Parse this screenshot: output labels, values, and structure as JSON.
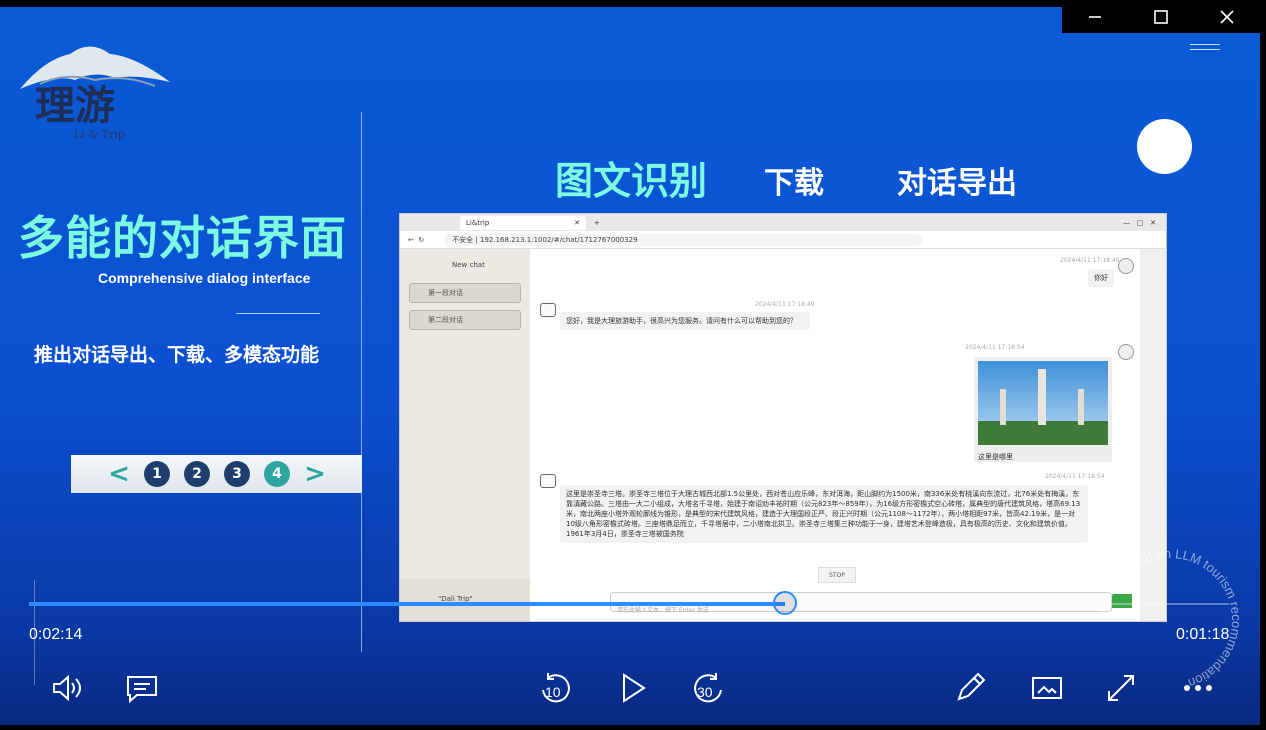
{
  "window": {
    "minimize_icon": "minimize-icon",
    "maximize_icon": "maximize-icon",
    "close_icon": "close-icon"
  },
  "slide": {
    "logo_text": "理游",
    "logo_subtext": "Li & Trip",
    "title_cn": "多能的对话界面",
    "title_en": "Comprehensive dialog interface",
    "subtitle": "推出对话导出、下载、多模态功能",
    "features": [
      "图文识别",
      "下载",
      "对话导出"
    ],
    "pager": {
      "prev": "<",
      "next": ">",
      "pages": [
        "1",
        "2",
        "3",
        "4"
      ],
      "active": "4"
    }
  },
  "browser": {
    "tab_title": "Li&trip",
    "url_warning": "不安全",
    "url": "192.168.213.1:1002/#/chat/1712767000329",
    "sidebar": {
      "new_chat": "New chat",
      "items": [
        "第一段对话",
        "第二段对话"
      ],
      "footer_name": "\"Dali Trip\""
    },
    "messages": [
      {
        "role": "user",
        "time": "2024/4/11 17:18:46",
        "text": "你好"
      },
      {
        "role": "bot",
        "time": "2024/4/11 17:18:49",
        "text": "您好，我是大理旅游助手，很高兴为您服务。请问有什么可以帮助到您的？"
      },
      {
        "role": "user",
        "time": "2024/4/11 17:18:54",
        "text": "这里是哪里"
      },
      {
        "role": "bot",
        "time": "2024/4/11 17:18:54",
        "text": "这里是崇圣寺三塔。崇圣寺三塔位于大理古城西北部1.5公里处，西对苍山应乐峰，东对洱海，距山脚约为1500米，南336米处有桃溪向东流过，北76米处有梅溪，东靠滇藏公路。三塔由一大二小组成，大塔名千寻塔，始建于南诏劝丰祐时期（公元823年～859年），为16级方形密檐式空心砖塔，属典型的唐代建筑风格，塔高69.13米，南北两座小塔外观轮廓线为锥形，是典型的宋代建筑风格，建造于大理国段正严、段正兴时期（公元1108～1172年），两小塔相距97米，皆高42.19米，是一对10级八角形密檐式砖塔。三座塔鼎足而立，千寻塔居中，二小塔南北拱卫。崇圣寺三塔集三种功能于一身，建塔艺术登峰造极，具有极高的历史、文化和建筑价值。1961年3月4日，崇圣寺三塔被国务院"
      }
    ],
    "stop_label": "STOP",
    "input_placeholder": "请在此输入文本，按下 Enter 发送"
  },
  "player": {
    "elapsed": "0:02:14",
    "remaining": "0:01:18",
    "progress_fraction": 0.63,
    "skip_back": "10",
    "skip_forward": "30",
    "watermark": "system based on LLM tourism recommendation"
  },
  "colors": {
    "accent": "#7dfbe0",
    "progress": "#2a8cff",
    "pager_active": "#2fa5a0",
    "pager_num": "#1f3e6e"
  }
}
